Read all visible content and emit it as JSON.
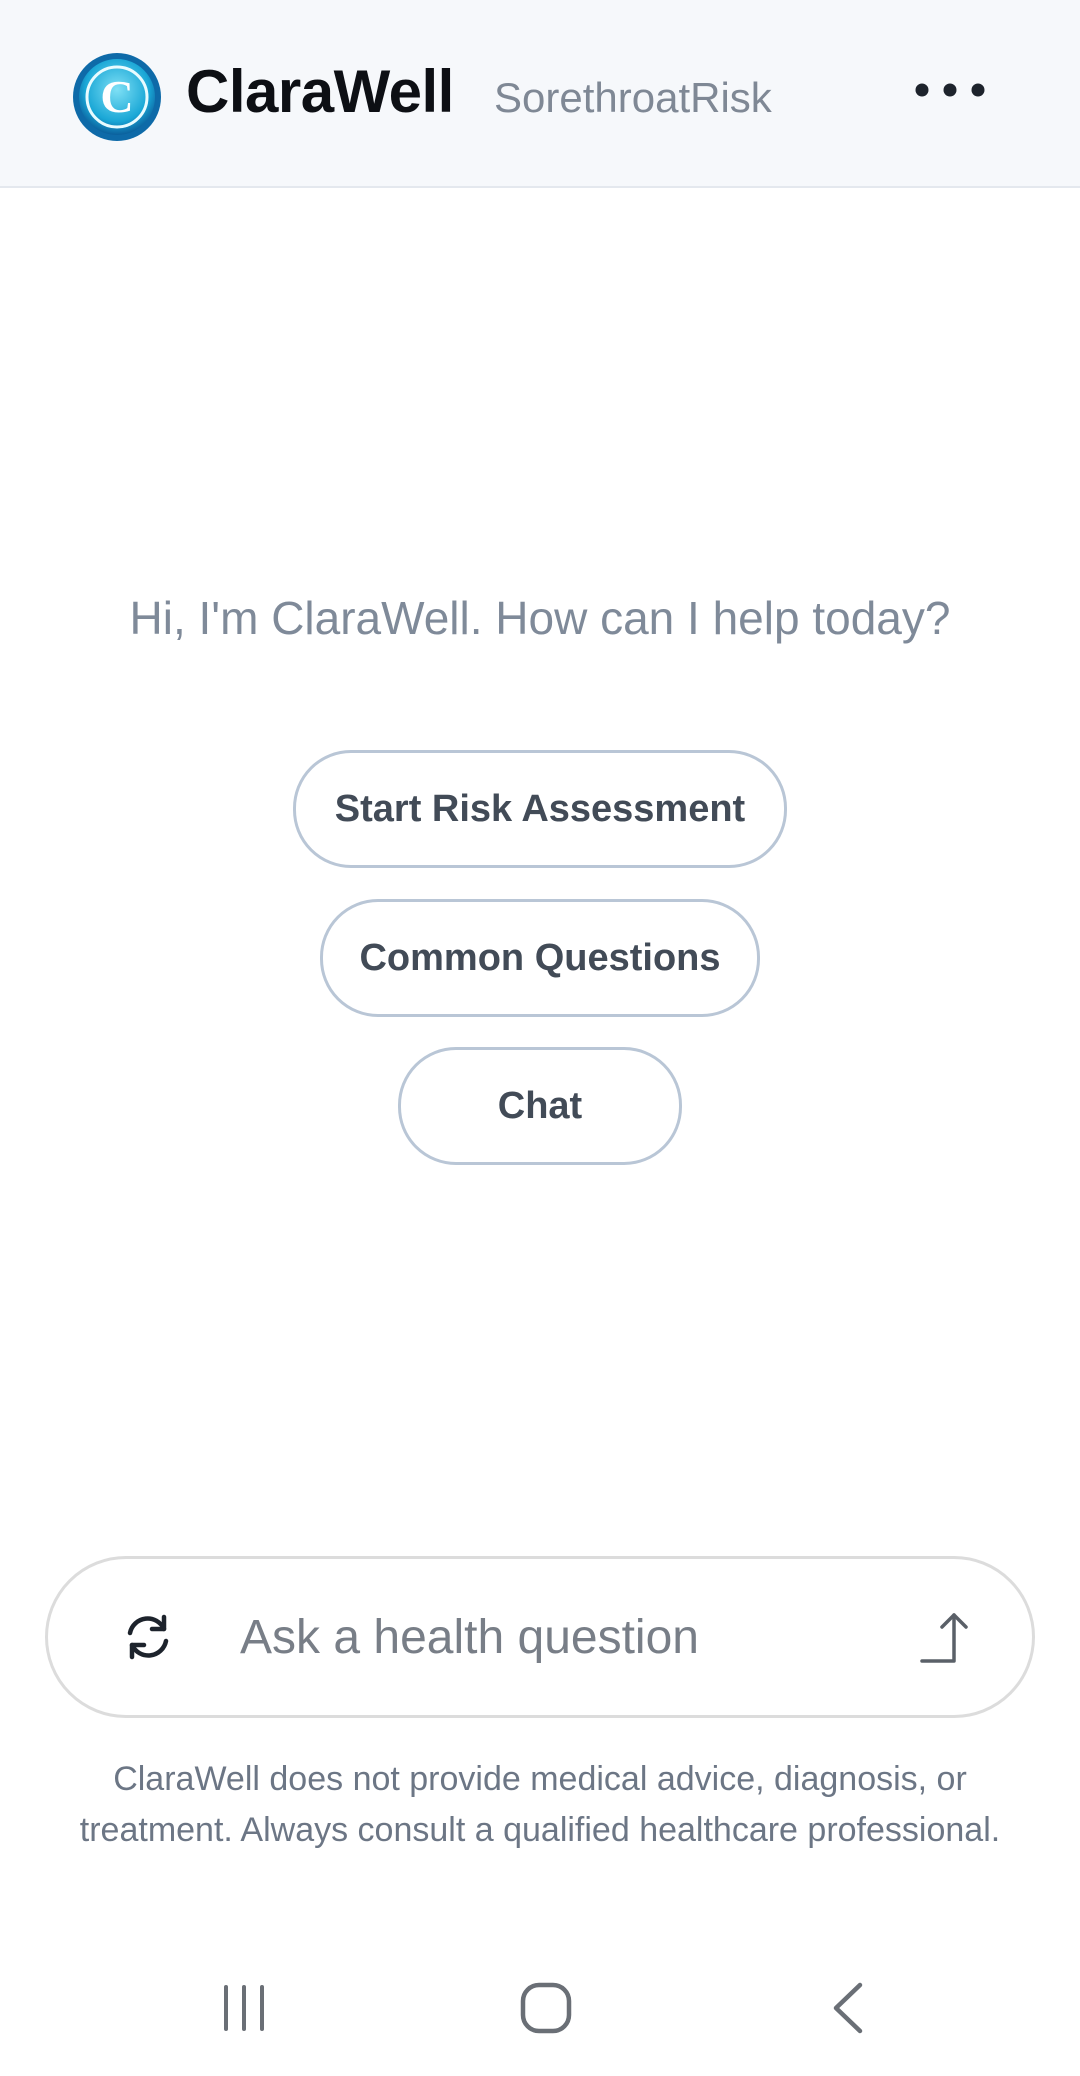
{
  "header": {
    "brand": "ClaraWell",
    "subtitle": "SorethroatRisk",
    "logo_letter": "C",
    "menu_icon": "more-horizontal-icon"
  },
  "main": {
    "greeting": "Hi, I'm ClaraWell. How can I help today?",
    "actions": [
      {
        "label": "Start Risk Assessment"
      },
      {
        "label": "Common Questions"
      },
      {
        "label": "Chat"
      }
    ]
  },
  "composer": {
    "placeholder": "Ask a health question",
    "value": "",
    "refresh_icon": "refresh-icon",
    "send_icon": "send-arrow-icon"
  },
  "disclaimer": "ClaraWell does not provide medical advice, diagnosis, or treatment. Always consult a qualified healthcare professional.",
  "navbar": {
    "recent_icon": "recent-apps-icon",
    "home_icon": "home-icon",
    "back_icon": "back-icon"
  },
  "colors": {
    "header_bg": "#f6f8fb",
    "button_border": "#b9c6d6",
    "button_text": "#424b57",
    "greeting_text": "#7f8a99",
    "logo_accent": "#1aa7d6"
  }
}
